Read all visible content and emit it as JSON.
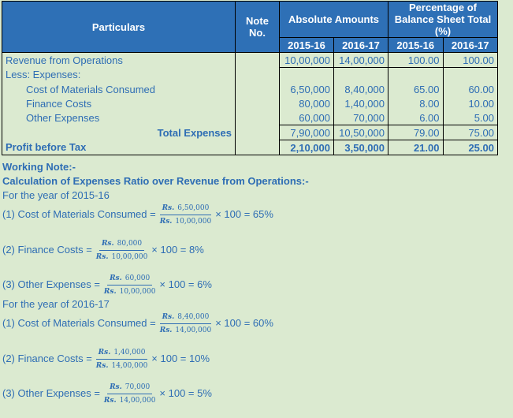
{
  "table": {
    "headers": {
      "particulars": "Particulars",
      "note_no": "Note No.",
      "absolute": "Absolute Amounts",
      "percentage": "Percentage of Balance Sheet Total (%)",
      "years": [
        "2015-16",
        "2016-17",
        "2015-16",
        "2016-17"
      ]
    },
    "rows": [
      {
        "label": "Revenue from Operations",
        "values": [
          "10,00,000",
          "14,00,000",
          "100.00",
          "100.00"
        ]
      },
      {
        "label": "Less: Expenses:",
        "values": [
          "",
          "",
          "",
          ""
        ]
      },
      {
        "label": "Cost of Materials Consumed",
        "values": [
          "6,50,000",
          "8,40,000",
          "65.00",
          "60.00"
        ]
      },
      {
        "label": "Finance Costs",
        "values": [
          "80,000",
          "1,40,000",
          "8.00",
          "10.00"
        ]
      },
      {
        "label": "Other Expenses",
        "values": [
          "60,000",
          "70,000",
          "6.00",
          "5.00"
        ]
      },
      {
        "label": "Total Expenses",
        "values": [
          "7,90,000",
          "10,50,000",
          "79.00",
          "75.00"
        ]
      },
      {
        "label": "Profit before Tax",
        "values": [
          "2,10,000",
          "3,50,000",
          "21.00",
          "25.00"
        ]
      }
    ]
  },
  "notes": {
    "title": "Working Note:-",
    "subtitle": "Calculation of Expenses Ratio over Revenue from Operations:-",
    "years": [
      {
        "heading": "For the year of 2015-16",
        "items": [
          {
            "label": "(1) Cost of Materials Consumed =",
            "rs": "Rs.",
            "num": "6,50,000",
            "den": "10,00,000",
            "result": "× 100 = 65%"
          },
          {
            "label": "(2) Finance Costs =",
            "rs": "Rs.",
            "num": "80,000",
            "den": "10,00,000",
            "result": "× 100 = 8%"
          },
          {
            "label": "(3) Other Expenses =",
            "rs": "Rs.",
            "num": "60,000",
            "den": "10,00,000",
            "result": "× 100 = 6%"
          }
        ]
      },
      {
        "heading": "For the year of 2016-17",
        "items": [
          {
            "label": "(1) Cost of Materials Consumed =",
            "rs": "Rs.",
            "num": "8,40,000",
            "den": "14,00,000",
            "result": "× 100 = 60%"
          },
          {
            "label": "(2) Finance Costs =",
            "rs": "Rs.",
            "num": "1,40,000",
            "den": "14,00,000",
            "result": "× 100 = 10%"
          },
          {
            "label": "(3) Other Expenses =",
            "rs": "Rs.",
            "num": "70,000",
            "den": "14,00,000",
            "result": "× 100 = 5%"
          }
        ]
      }
    ]
  }
}
